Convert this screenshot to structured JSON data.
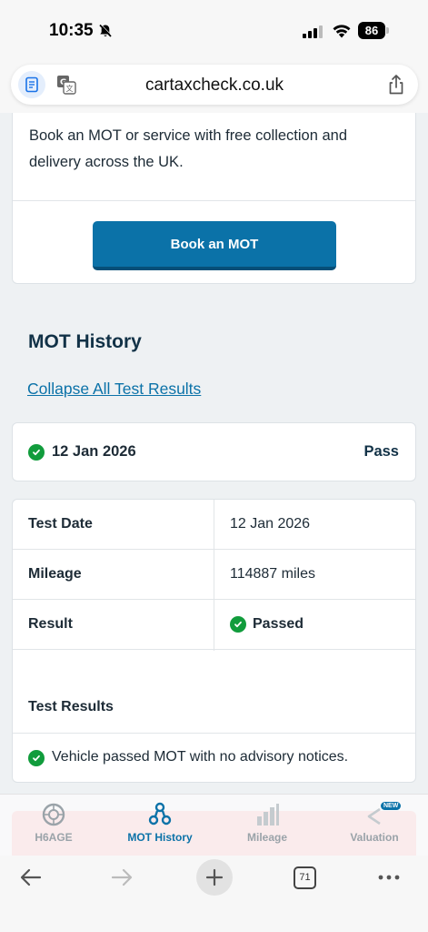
{
  "status_bar": {
    "time": "10:35",
    "battery": "86"
  },
  "browser": {
    "url": "cartaxcheck.co.uk",
    "tabs_count": "71"
  },
  "promo": {
    "text": "Book an MOT or service with free collection and delivery across the UK.",
    "button_label": "Book an MOT"
  },
  "mot": {
    "section_title": "MOT History",
    "collapse_label": "Collapse All Test Results",
    "latest": {
      "date": "12 Jan 2026",
      "status": "Pass"
    },
    "details": {
      "test_date_label": "Test Date",
      "test_date_value": "12 Jan 2026",
      "mileage_label": "Mileage",
      "mileage_value": "114887 miles",
      "result_label": "Result",
      "result_value": "Passed",
      "test_results_title": "Test Results",
      "test_results_text": "Vehicle passed MOT with no advisory notices."
    }
  },
  "site_nav": {
    "items": [
      {
        "label": "H6AGE",
        "icon": "wheel-icon"
      },
      {
        "label": "MOT History",
        "icon": "mot-triangle-icon"
      },
      {
        "label": "Mileage",
        "icon": "bar-chart-icon"
      },
      {
        "label": "Valuation",
        "icon": "less-than-icon",
        "badge": "NEW"
      }
    ]
  },
  "colors": {
    "accent": "#0b72a8",
    "pass_green": "#119c3c",
    "title": "#123247"
  }
}
